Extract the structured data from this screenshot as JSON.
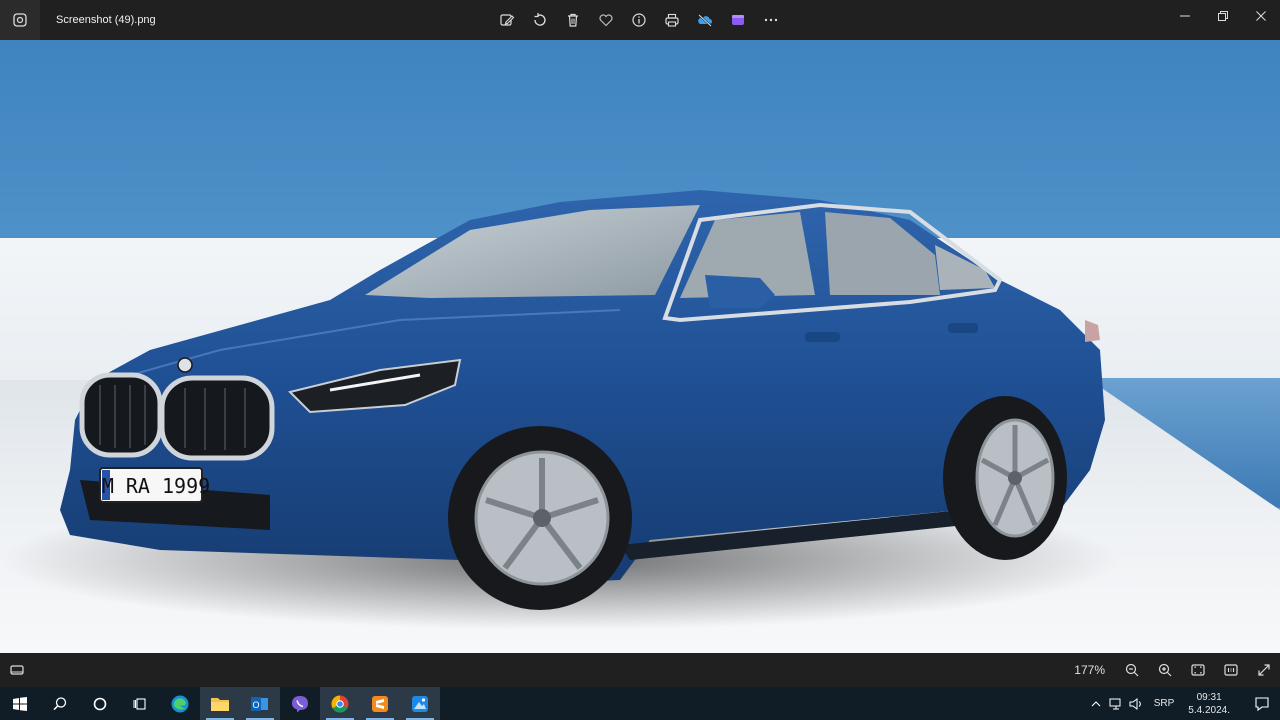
{
  "window": {
    "filename": "Screenshot (49).png"
  },
  "toolbar": {
    "icons": [
      "edit-icon",
      "rotate-icon",
      "delete-icon",
      "favorite-icon",
      "info-icon",
      "print-icon",
      "onedrive-icon",
      "clipchamp-icon",
      "more-icon"
    ]
  },
  "image": {
    "plate_text": "M RA 1999",
    "car_color": "#1f4f93"
  },
  "statusbar": {
    "zoom": "177%"
  },
  "taskbar": {
    "apps": [
      "edge",
      "file-explorer",
      "outlook",
      "viber",
      "chrome",
      "sublime",
      "photos"
    ],
    "lang": "SRP",
    "time": "09:31",
    "date": "5.4.2024."
  }
}
